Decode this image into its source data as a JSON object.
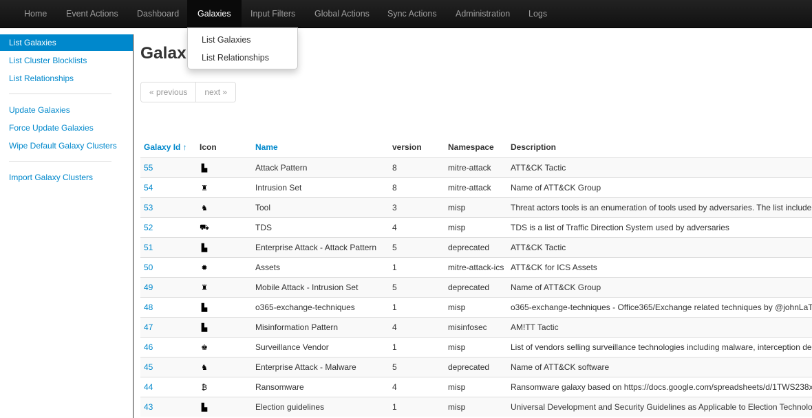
{
  "navbar": {
    "items": [
      "Home",
      "Event Actions",
      "Dashboard",
      "Galaxies",
      "Input Filters",
      "Global Actions",
      "Sync Actions",
      "Administration",
      "Logs"
    ],
    "active": "Galaxies"
  },
  "dropdown": {
    "items": [
      "List Galaxies",
      "List Relationships"
    ]
  },
  "sidebar": {
    "items": [
      "List Galaxies",
      "List Cluster Blocklists",
      "List Relationships",
      "Update Galaxies",
      "Force Update Galaxies",
      "Wipe Default Galaxy Clusters",
      "Import Galaxy Clusters"
    ],
    "active": "List Galaxies"
  },
  "page": {
    "title": "Galaxies"
  },
  "pager": {
    "previous": "« previous",
    "next": "next »"
  },
  "table": {
    "headers": {
      "id": "Galaxy Id ↑",
      "icon": "Icon",
      "name": "Name",
      "version": "version",
      "namespace": "Namespace",
      "description": "Description"
    },
    "rows": [
      {
        "id": "55",
        "icon": "map-icon",
        "glyph": "▙",
        "name": "Attack Pattern",
        "version": "8",
        "namespace": "mitre-attack",
        "description": "ATT&CK Tactic"
      },
      {
        "id": "54",
        "icon": "user-secret-icon",
        "glyph": "♜",
        "name": "Intrusion Set",
        "version": "8",
        "namespace": "mitre-attack",
        "description": "Name of ATT&CK Group"
      },
      {
        "id": "53",
        "icon": "user-ninja-icon",
        "glyph": "♞",
        "name": "Tool",
        "version": "3",
        "namespace": "misp",
        "description": "Threat actors tools is an enumeration of tools used by adversaries. The list include"
      },
      {
        "id": "52",
        "icon": "shopping-cart-icon",
        "glyph": "⛟",
        "name": "TDS",
        "version": "4",
        "namespace": "misp",
        "description": "TDS is a list of Traffic Direction System used by adversaries"
      },
      {
        "id": "51",
        "icon": "map-icon",
        "glyph": "▙",
        "name": "Enterprise Attack - Attack Pattern",
        "version": "5",
        "namespace": "deprecated",
        "description": "ATT&CK Tactic"
      },
      {
        "id": "50",
        "icon": "certificate-icon",
        "glyph": "✹",
        "name": "Assets",
        "version": "1",
        "namespace": "mitre-attack-ics",
        "description": "ATT&CK for ICS Assets"
      },
      {
        "id": "49",
        "icon": "user-secret-icon",
        "glyph": "♜",
        "name": "Mobile Attack - Intrusion Set",
        "version": "5",
        "namespace": "deprecated",
        "description": "Name of ATT&CK Group"
      },
      {
        "id": "48",
        "icon": "map-icon",
        "glyph": "▙",
        "name": "o365-exchange-techniques",
        "version": "1",
        "namespace": "misp",
        "description": "o365-exchange-techniques - Office365/Exchange related techniques by @johnLaT"
      },
      {
        "id": "47",
        "icon": "map-icon",
        "glyph": "▙",
        "name": "Misinformation Pattern",
        "version": "4",
        "namespace": "misinfosec",
        "description": "AM!TT Tactic"
      },
      {
        "id": "46",
        "icon": "user-lock-icon",
        "glyph": "♚",
        "name": "Surveillance Vendor",
        "version": "1",
        "namespace": "misp",
        "description": "List of vendors selling surveillance technologies including malware, interception de"
      },
      {
        "id": "45",
        "icon": "user-ninja-icon",
        "glyph": "♞",
        "name": "Enterprise Attack - Malware",
        "version": "5",
        "namespace": "deprecated",
        "description": "Name of ATT&CK software"
      },
      {
        "id": "44",
        "icon": "bitcoin-icon",
        "glyph": "₿",
        "name": "Ransomware",
        "version": "4",
        "namespace": "misp",
        "description": "Ransomware galaxy based on https://docs.google.com/spreadsheets/d/1TWS238x"
      },
      {
        "id": "43",
        "icon": "map-icon",
        "glyph": "▙",
        "name": "Election guidelines",
        "version": "1",
        "namespace": "misp",
        "description": "Universal Development and Security Guidelines as Applicable to Election Technolo"
      }
    ]
  }
}
